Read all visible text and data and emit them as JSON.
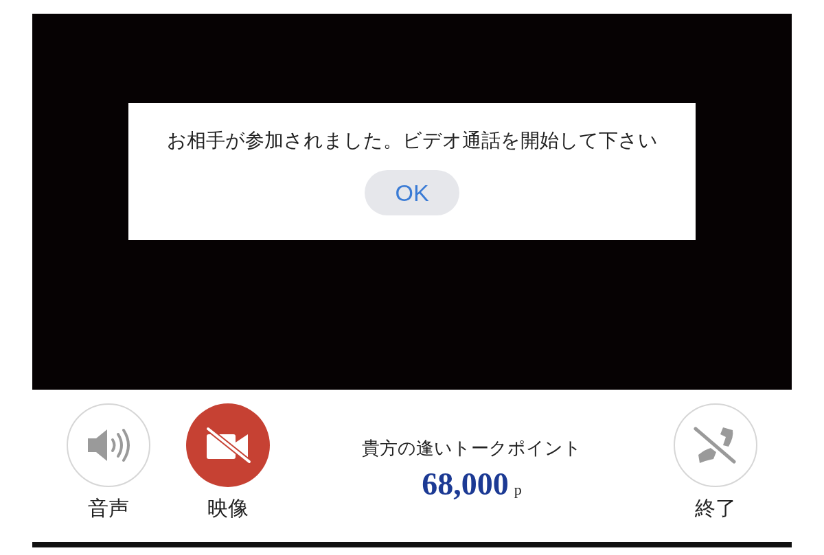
{
  "dialog": {
    "message": "お相手が参加されました。ビデオ通話を開始して下さい",
    "button": "OK"
  },
  "controls": [
    {
      "kind": "audio",
      "label": "音声",
      "active": false
    },
    {
      "kind": "video",
      "label": "映像",
      "active": true
    }
  ],
  "points": {
    "title": "貴方の逢いトークポイント",
    "value": "68,000",
    "unit": "p"
  },
  "end_call": {
    "kind": "end",
    "label": "終了",
    "active": false
  }
}
